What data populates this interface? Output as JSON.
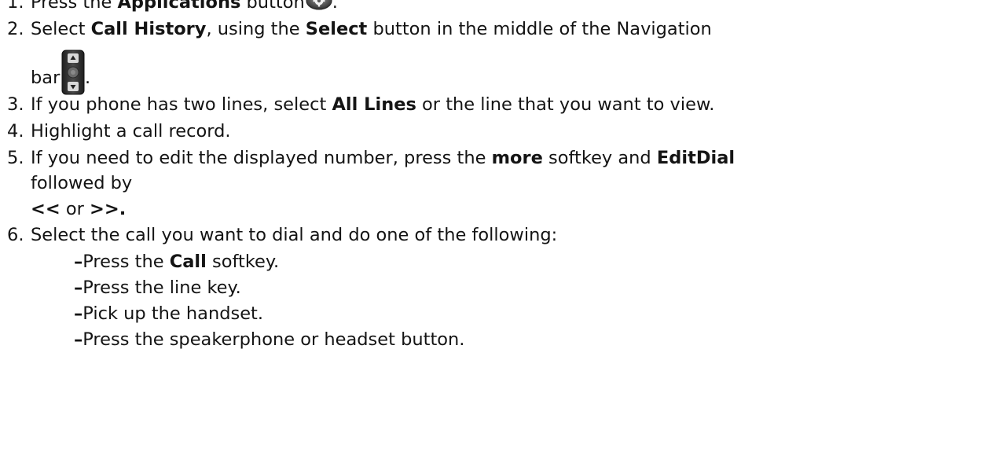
{
  "steps": [
    {
      "num": "1.",
      "before": "Press the ",
      "bold": "Applications",
      "after": " button",
      "end": ".",
      "icon": "applications-gear-icon"
    },
    {
      "num": "2.",
      "a": "Select ",
      "bold1": "Call History",
      "b": ", using the ",
      "bold2": "Select",
      "c": " button in the middle of the Navigation",
      "cont": "bar",
      "end": ".",
      "icon": "navigation-bar-icon"
    },
    {
      "num": "3.",
      "a": "If you phone has two lines, select ",
      "bold": "All Lines",
      "b": " or the line that you want to view."
    },
    {
      "num": "4.",
      "text": "Highlight a call record."
    },
    {
      "num": "5.",
      "a": "If you need to edit the displayed number, press the ",
      "bold1": "more",
      "b": " softkey and ",
      "bold2": "EditDial",
      "line2": "followed by",
      "l3_bold1": "<<",
      "l3_mid": " or ",
      "l3_bold2": ">>."
    },
    {
      "num": "6.",
      "text": "Select the call you want to dial and do one of the following:",
      "subitems": [
        {
          "dash": "–",
          "a": "Press the ",
          "bold": "Call",
          "b": " softkey."
        },
        {
          "dash": "–",
          "a": "Press the line key.",
          "bold": "",
          "b": ""
        },
        {
          "dash": "–",
          "a": "Pick up the handset.",
          "bold": "",
          "b": ""
        },
        {
          "dash": "–",
          "a": "Press the speakerphone or headset button.",
          "bold": "",
          "b": ""
        }
      ]
    }
  ],
  "colors": {
    "text": "#141414",
    "icon_dark": "#3a3a3a",
    "icon_light": "#c8c8c8"
  }
}
